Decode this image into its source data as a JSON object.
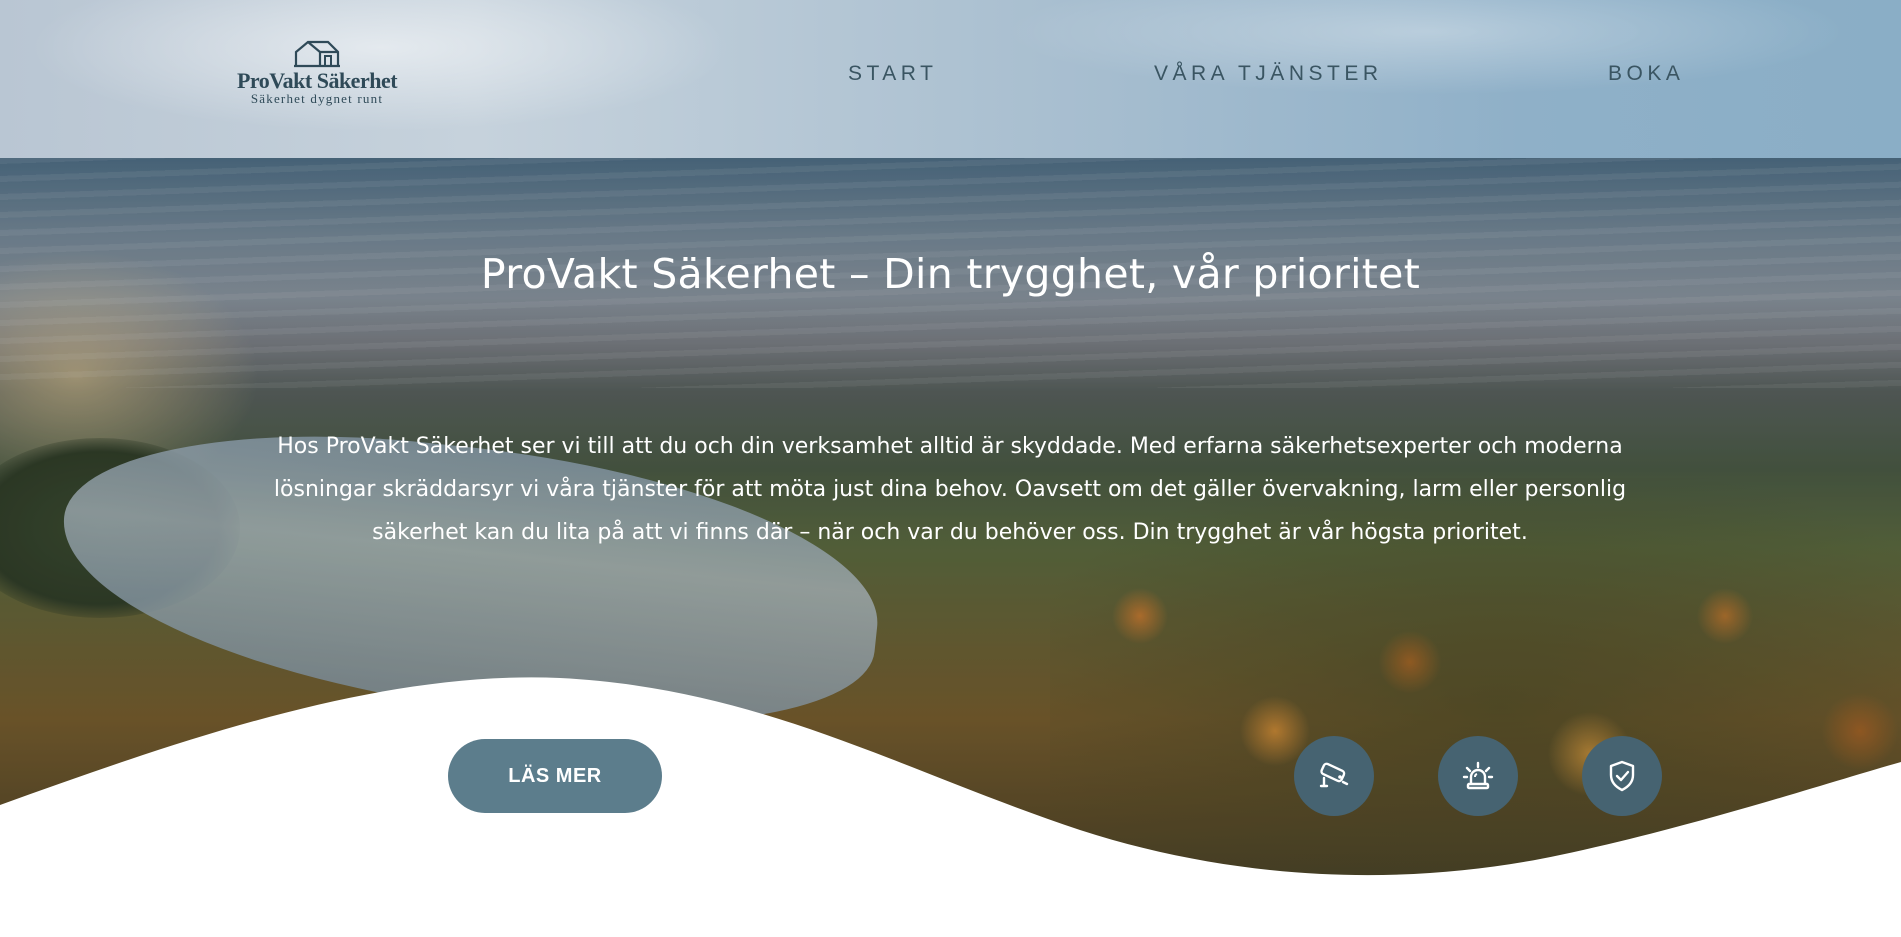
{
  "header": {
    "logo": {
      "name": "ProVakt Säkerhet",
      "tagline": "Säkerhet dygnet runt",
      "icon": "house-icon"
    },
    "nav": [
      {
        "label": "START"
      },
      {
        "label": "VÅRA TJÄNSTER"
      },
      {
        "label": "BOKA"
      }
    ]
  },
  "hero": {
    "title": "ProVakt Säkerhet – Din trygghet, vår prioritet",
    "text": "Hos ProVakt Säkerhet ser vi till att du och din verksamhet alltid är skyddade. Med erfarna säkerhetsexperter och moderna lösningar skräddarsyr vi våra tjänster för att möta just dina behov. Oavsett om det gäller övervakning, larm eller personlig säkerhet kan du lita på att vi finns där – när och var du behöver oss. Din trygghet är vår högsta prioritet.",
    "cta_label": "LÄS MER",
    "feature_icons": [
      "security-camera-icon",
      "alarm-light-icon",
      "shield-check-icon"
    ]
  },
  "colors": {
    "accent": "#5c7d8c",
    "icon_bg": "#466371",
    "nav_text": "#3a5562"
  }
}
